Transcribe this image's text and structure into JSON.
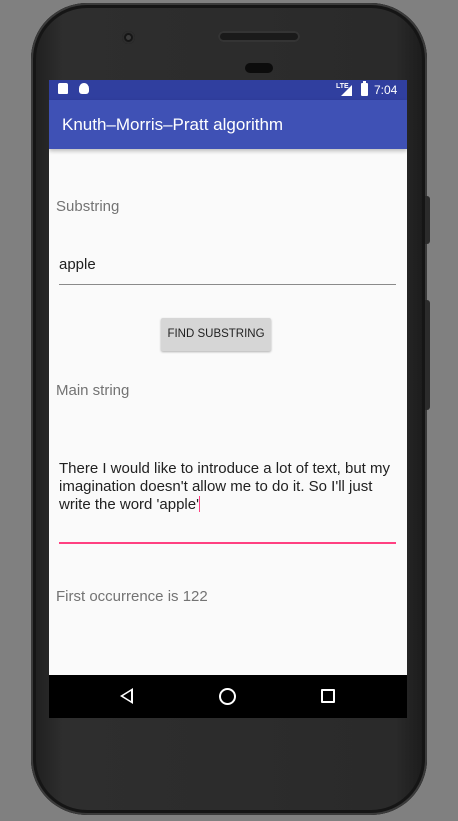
{
  "status_bar": {
    "time": "7:04",
    "network": "LTE",
    "left_icons": [
      "sd-card-icon",
      "android-icon"
    ]
  },
  "app_bar": {
    "title": "Knuth–Morris–Pratt algorithm",
    "color": "#3f51b5"
  },
  "substring": {
    "label": "Substring",
    "value": "apple"
  },
  "find_button": {
    "label": "FIND SUBSTRING"
  },
  "main_string": {
    "label": "Main string",
    "value": "There I would like to introduce a lot of text, but my imagination doesn't allow me to do it. So I'll just write the word 'apple'"
  },
  "result": {
    "text": "First occurrence is 122"
  },
  "colors": {
    "status_bar": "#303f9f",
    "accent": "#ff4081",
    "background": "#fafafa"
  },
  "nav_bar": {
    "icons": [
      "back-icon",
      "home-icon",
      "recents-icon"
    ]
  }
}
